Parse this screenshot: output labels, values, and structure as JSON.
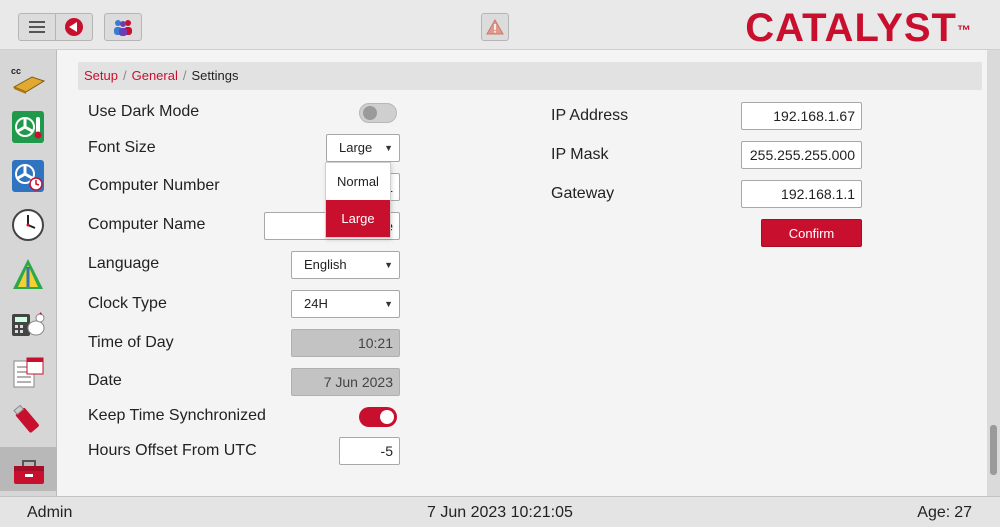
{
  "brand": {
    "name": "CATALYST",
    "tm": "™"
  },
  "breadcrumb": {
    "setup": "Setup",
    "general": "General",
    "current": "Settings",
    "separator": "/"
  },
  "settings": {
    "dark_mode": {
      "label": "Use Dark Mode",
      "enabled": false
    },
    "font_size": {
      "label": "Font Size",
      "value": "Large",
      "options": [
        "Normal",
        "Large"
      ]
    },
    "computer_number": {
      "label": "Computer Number",
      "value": "1"
    },
    "computer_name": {
      "label": "Computer Name",
      "value_tail": "e"
    },
    "language": {
      "label": "Language",
      "value": "English"
    },
    "clock_type": {
      "label": "Clock Type",
      "value": "24H"
    },
    "time_of_day": {
      "label": "Time of Day",
      "value": "10:21"
    },
    "date": {
      "label": "Date",
      "value": "7 Jun 2023"
    },
    "keep_sync": {
      "label": "Keep Time Synchronized",
      "enabled": true
    },
    "utc_offset": {
      "label": "Hours Offset From UTC",
      "value": "-5"
    }
  },
  "network": {
    "ip_address": {
      "label": "IP Address",
      "value": "192.168.1.67"
    },
    "ip_mask": {
      "label": "IP Mask",
      "value": "255.255.255.000"
    },
    "gateway": {
      "label": "Gateway",
      "value": "192.168.1.1"
    },
    "confirm_label": "Confirm"
  },
  "sidebar": {
    "items": [
      {
        "icon": "cc-house-icon",
        "text": "cc"
      },
      {
        "icon": "fan-thermometer-icon"
      },
      {
        "icon": "fan-clock-icon"
      },
      {
        "icon": "clock-icon"
      },
      {
        "icon": "feed-line-icon"
      },
      {
        "icon": "calculator-chicken-icon"
      },
      {
        "icon": "calendar-list-icon"
      },
      {
        "icon": "usb-drive-icon"
      },
      {
        "icon": "toolbox-icon"
      }
    ]
  },
  "toolbar": {
    "menu_icon": "menu-icon",
    "back_icon": "back-arrow-icon",
    "users_icon": "users-icon",
    "alarm_icon": "warning-icon"
  },
  "footer": {
    "user": "Admin",
    "datetime": "7 Jun 2023 10:21:05",
    "age_label": "Age:",
    "age_value": "27"
  },
  "colors": {
    "accent": "#c8102e",
    "background": "#f4f4f4",
    "sidebar": "#d6d6d6"
  }
}
